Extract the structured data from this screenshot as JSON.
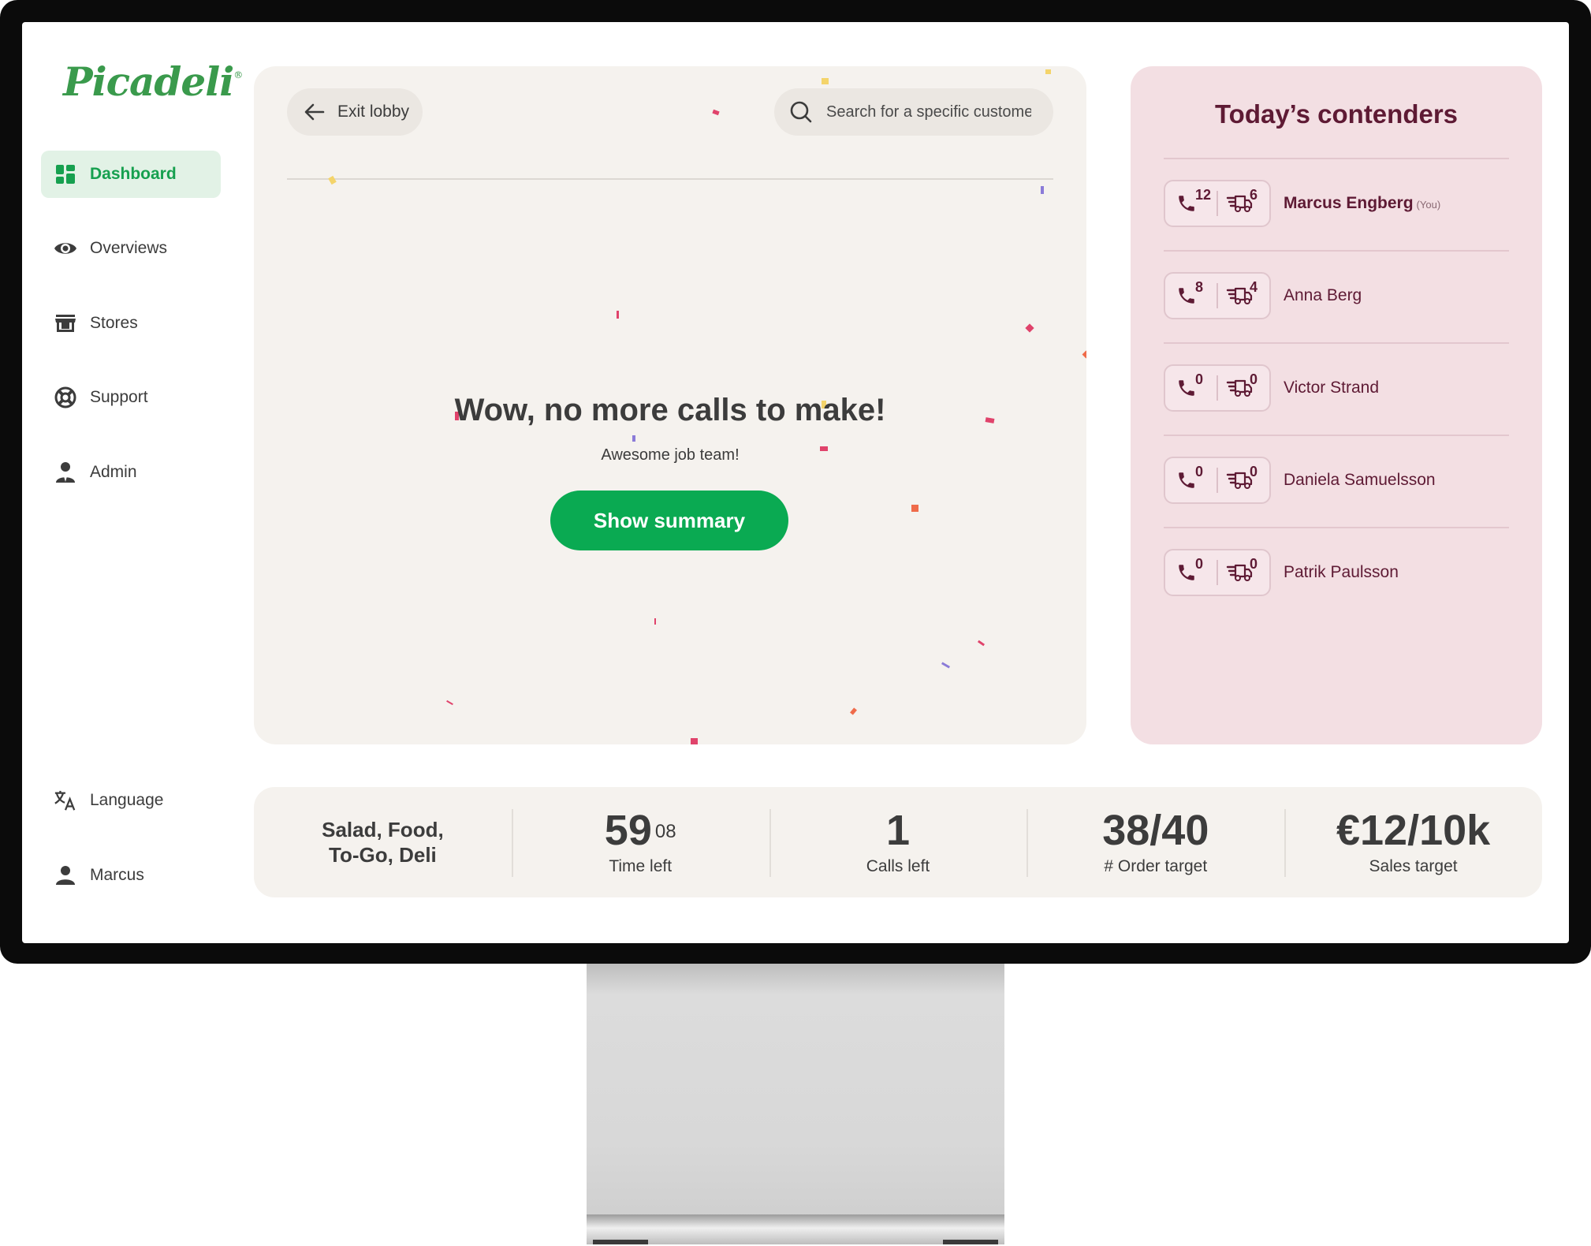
{
  "brand": {
    "name": "Picadeli",
    "mark": "®",
    "color": "#3a9a4c"
  },
  "sidebar": {
    "items": [
      {
        "label": "Dashboard",
        "icon": "dashboard-icon",
        "active": true
      },
      {
        "label": "Overviews",
        "icon": "eye-icon"
      },
      {
        "label": "Stores",
        "icon": "store-icon"
      },
      {
        "label": "Support",
        "icon": "lifebuoy-icon"
      },
      {
        "label": "Admin",
        "icon": "admin-user-icon"
      }
    ],
    "footer": [
      {
        "label": "Language",
        "icon": "translate-icon"
      },
      {
        "label": "Marcus",
        "icon": "user-icon"
      }
    ]
  },
  "lobby": {
    "exit_label": "Exit lobby",
    "search_placeholder": "Search for a specific customer",
    "headline": "Wow, no more calls to make!",
    "subline": "Awesome job team!",
    "summary_button": "Show summary"
  },
  "contenders": {
    "title": "Today’s contenders",
    "you_tag": "(You)",
    "list": [
      {
        "name": "Marcus Engberg",
        "calls": "12",
        "orders": "6",
        "is_you": true
      },
      {
        "name": "Anna Berg",
        "calls": "8",
        "orders": "4"
      },
      {
        "name": "Victor Strand",
        "calls": "0",
        "orders": "0"
      },
      {
        "name": "Daniela Samuelsson",
        "calls": "0",
        "orders": "0"
      },
      {
        "name": "Patrik Paulsson",
        "calls": "0",
        "orders": "0"
      }
    ]
  },
  "stats": {
    "tags_line1": "Salad, Food,",
    "tags_line2": "To-Go, Deli",
    "time_left": {
      "value": "59",
      "sup": "08",
      "label": "Time left"
    },
    "calls_left": {
      "value": "1",
      "label": "Calls left"
    },
    "order_target": {
      "value": "38/40",
      "label": "# Order target"
    },
    "sales_target": {
      "value": "€12/10k",
      "label": "Sales target"
    }
  },
  "colors": {
    "primary_green": "#0aaa52",
    "active_nav_bg": "#e2f2e6",
    "contenders_bg": "#f3dfe3",
    "contenders_text": "#5e1a34",
    "card_bg": "#f5f2ee"
  }
}
